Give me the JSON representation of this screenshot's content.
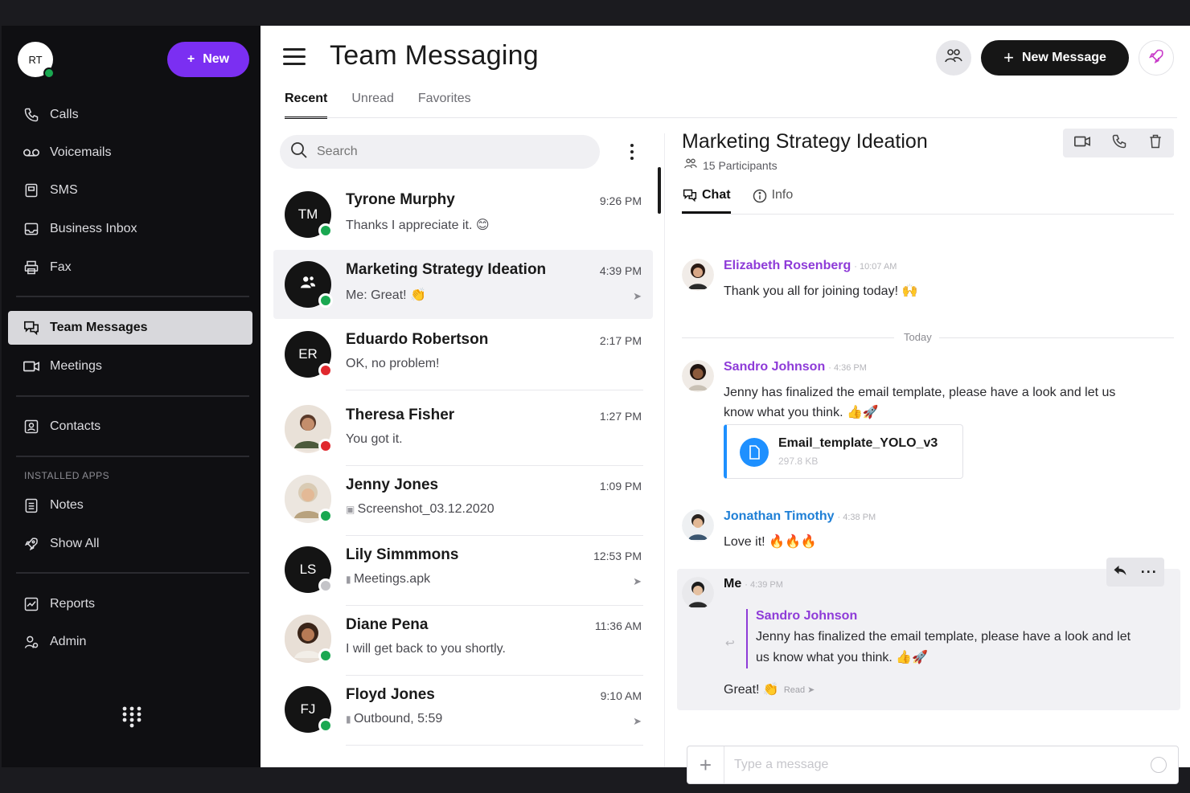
{
  "sidebar": {
    "user_initials": "RT",
    "new_label": "New",
    "items": [
      {
        "label": "Calls",
        "icon": "phone-icon"
      },
      {
        "label": "Voicemails",
        "icon": "voicemail-icon"
      },
      {
        "label": "SMS",
        "icon": "sms-icon"
      },
      {
        "label": "Business Inbox",
        "icon": "inbox-icon"
      },
      {
        "label": "Fax",
        "icon": "fax-icon"
      },
      {
        "label": "Team Messages",
        "icon": "chat-bubbles-icon"
      },
      {
        "label": "Meetings",
        "icon": "video-icon"
      },
      {
        "label": "Contacts",
        "icon": "contact-card-icon"
      },
      {
        "label": "Notes",
        "icon": "notes-icon"
      },
      {
        "label": "Show All",
        "icon": "rocket-icon"
      },
      {
        "label": "Reports",
        "icon": "reports-icon"
      },
      {
        "label": "Admin",
        "icon": "admin-icon"
      }
    ],
    "installed_apps_header": "INSTALLED APPS"
  },
  "header": {
    "title": "Team Messaging",
    "new_message_label": "New Message",
    "tabs": [
      "Recent",
      "Unread",
      "Favorites"
    ]
  },
  "list": {
    "search_placeholder": "Search",
    "conversations": [
      {
        "name": "Tyrone Murphy",
        "initials": "TM",
        "preview": "Thanks I appreciate it. 😊",
        "time": "9:26 PM",
        "status": "green"
      },
      {
        "name": "Marketing Strategy Ideation",
        "initials": "",
        "preview": "Me: Great! 👏",
        "time": "4:39 PM",
        "status": "green"
      },
      {
        "name": "Eduardo Robertson",
        "initials": "ER",
        "preview": "OK, no problem!",
        "time": "2:17 PM",
        "status": "red"
      },
      {
        "name": "Theresa Fisher",
        "initials": "",
        "preview": "You got it.",
        "time": "1:27 PM",
        "status": "red"
      },
      {
        "name": "Jenny Jones",
        "initials": "",
        "preview": "Screenshot_03.12.2020",
        "time": "1:09 PM",
        "status": "green"
      },
      {
        "name": "Lily Simmmons",
        "initials": "LS",
        "preview": "Meetings.apk",
        "time": "12:53 PM",
        "status": "gray"
      },
      {
        "name": "Diane Pena",
        "initials": "",
        "preview": "I will get back to you shortly.",
        "time": "11:36 AM",
        "status": "green"
      },
      {
        "name": "Floyd Jones",
        "initials": "FJ",
        "preview": "Outbound, 5:59",
        "time": "9:10 AM",
        "status": "green"
      }
    ]
  },
  "chat": {
    "title": "Marketing Strategy Ideation",
    "participants": "15 Participants",
    "tabs": [
      "Chat",
      "Info"
    ],
    "day_label": "Today",
    "messages": [
      {
        "author": "Elizabeth Rosenberg",
        "time": "10:07 AM",
        "text": "Thank you all for joining today! 🙌"
      },
      {
        "author": "Sandro Johnson",
        "time": "4:36 PM",
        "text": "Jenny has finalized the email template, please have a look and let us know what you think. 👍🚀"
      },
      {
        "author": "Jonathan Timothy",
        "time": "4:38 PM",
        "text": "Love it! 🔥🔥🔥"
      },
      {
        "author": "Me",
        "time": "4:39 PM",
        "text": "Great! 👏",
        "read": "Read"
      }
    ],
    "file": {
      "name": "Email_template_YOLO_v3",
      "size": "297.8 KB"
    },
    "quote": {
      "author": "Sandro Johnson",
      "text": "Jenny has finalized the email template, please have a look and let us know what you think. 👍🚀"
    },
    "composer_placeholder": "Type a message"
  }
}
